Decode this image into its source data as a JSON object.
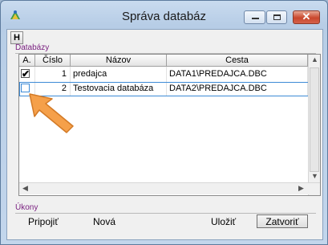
{
  "window": {
    "title": "Správa databáz",
    "minimize_icon": "minimize-icon",
    "maximize_icon": "maximize-icon",
    "close_icon": "close-icon",
    "close_glyph": "✕"
  },
  "toolbar": {
    "h_label": "H"
  },
  "databases_group": {
    "label": "Databázy",
    "columns": [
      "A.",
      "Číslo",
      "Názov",
      "Cesta"
    ],
    "rows": [
      {
        "active": true,
        "number": "1",
        "name": "predajca",
        "path": "DATA1\\PREDAJCA.DBC"
      },
      {
        "active": false,
        "number": "2",
        "name": "Testovacia databáza",
        "path": "DATA2\\PREDAJCA.DBC"
      }
    ],
    "selected_row": 2,
    "scroll_up_glyph": "▲",
    "scroll_down_glyph": "▼",
    "scroll_left_glyph": "◀",
    "scroll_right_glyph": "▶"
  },
  "actions_group": {
    "label": "Úkony",
    "connect": "Pripojiť",
    "new": "Nová",
    "save": "Uložiť",
    "close": "Zatvoriť"
  },
  "colors": {
    "accent": "#3d8bd6",
    "group_label": "#7a2080",
    "pointer": "#f5a04a"
  }
}
